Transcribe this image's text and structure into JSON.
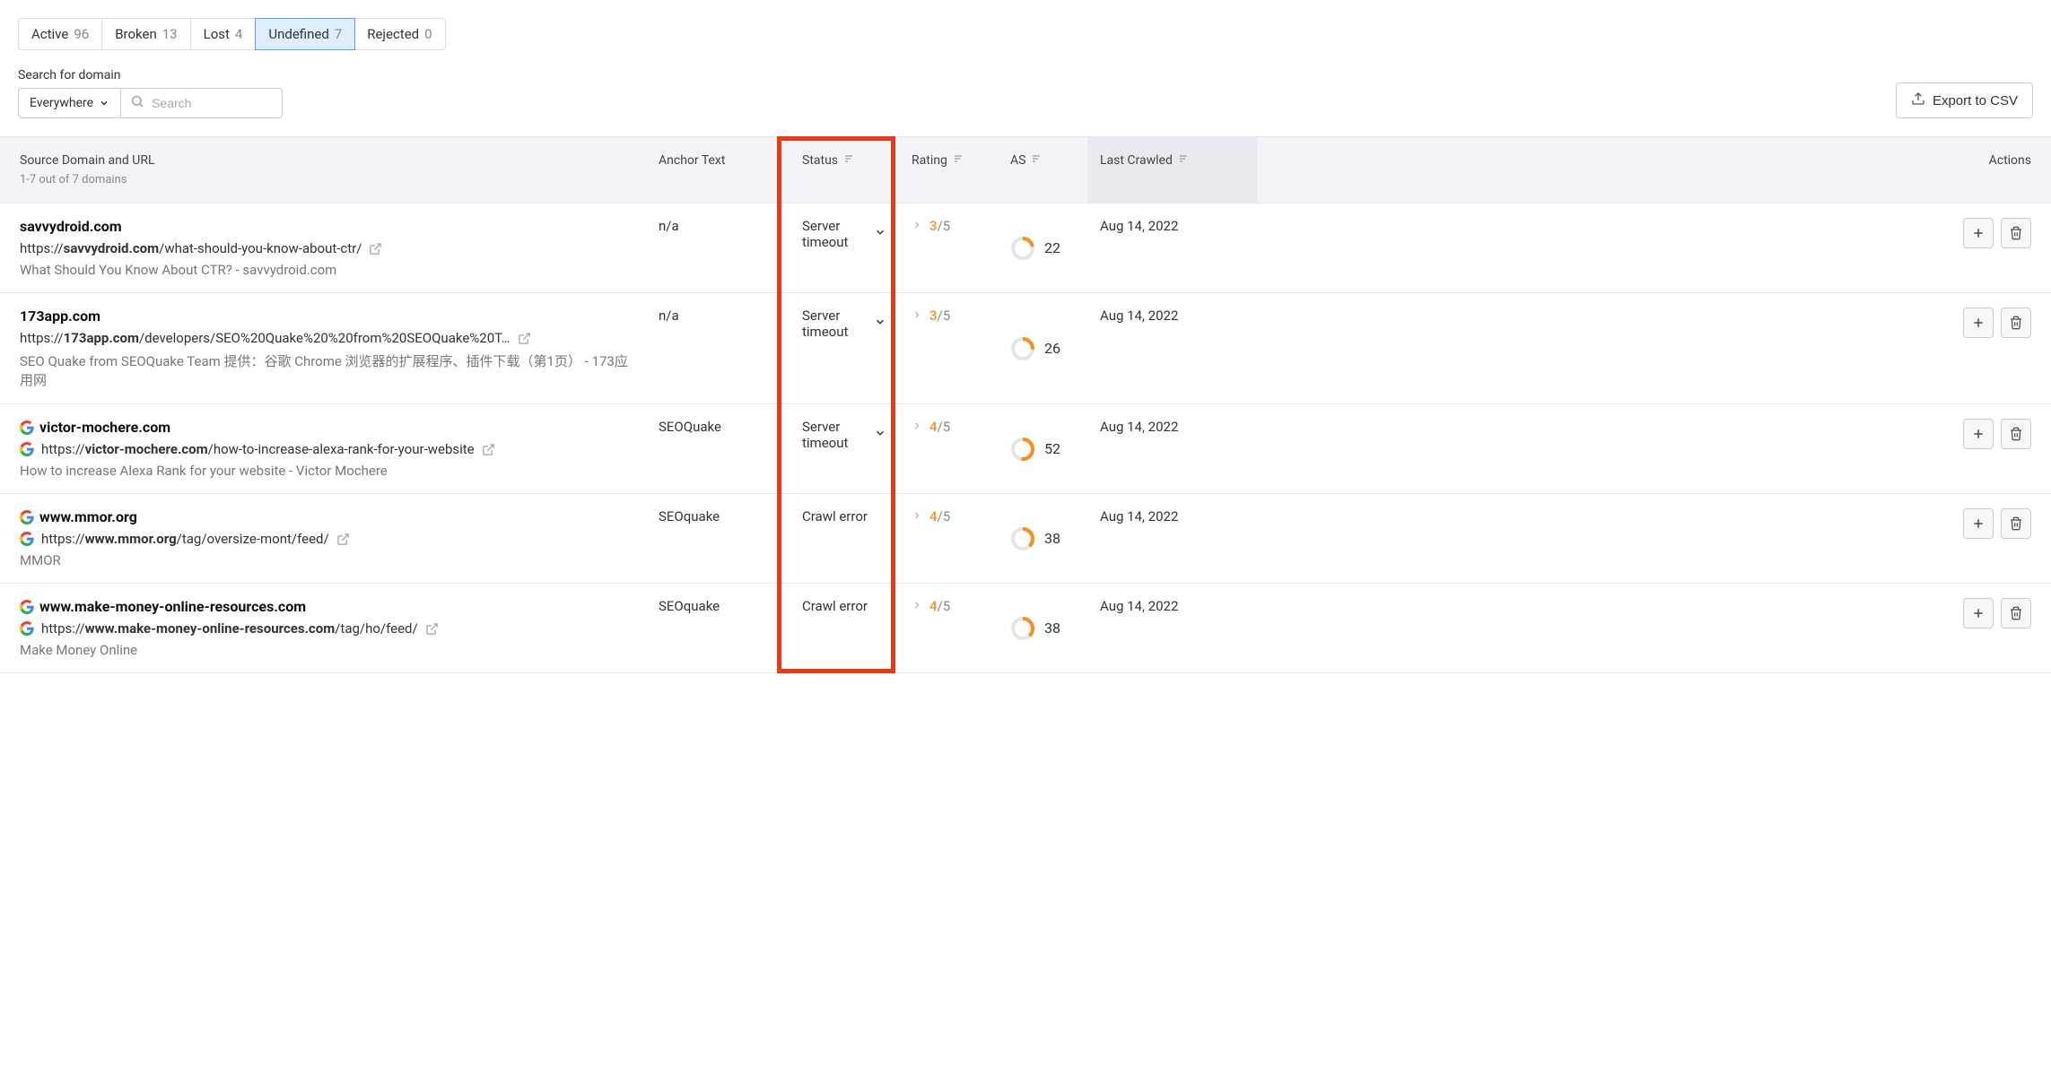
{
  "tabs": [
    {
      "label": "Active",
      "count": "96",
      "selected": false
    },
    {
      "label": "Broken",
      "count": "13",
      "selected": false
    },
    {
      "label": "Lost",
      "count": "4",
      "selected": false
    },
    {
      "label": "Undefined",
      "count": "7",
      "selected": true
    },
    {
      "label": "Rejected",
      "count": "0",
      "selected": false
    }
  ],
  "search": {
    "label": "Search for domain",
    "scope": "Everywhere",
    "placeholder": "Search"
  },
  "export_label": "Export to CSV",
  "columns": {
    "domain": "Source Domain and URL",
    "domain_sub": "1-7 out of 7 domains",
    "anchor": "Anchor Text",
    "status": "Status",
    "rating": "Rating",
    "as": "AS",
    "crawled": "Last Crawled",
    "actions": "Actions"
  },
  "rows": [
    {
      "has_favicon": false,
      "domain": "savvydroid.com",
      "url_prefix": "https://",
      "url_bold": "savvydroid.com",
      "url_rest": "/what-should-you-know-about-ctr/",
      "title": "What Should You Know About CTR? - savvydroid.com",
      "anchor": "n/a",
      "status": "Server timeout",
      "status_expandable": true,
      "rating_num": "3",
      "rating_total": "/5",
      "as": "22",
      "as_pct": 22,
      "crawled": "Aug 14, 2022"
    },
    {
      "has_favicon": false,
      "domain": "173app.com",
      "url_prefix": "https://",
      "url_bold": "173app.com",
      "url_rest": "/developers/SEO%20Quake%20%20from%20SEOQuake%20T…",
      "title": "SEO Quake from SEOQuake Team 提供：谷歌 Chrome 浏览器的扩展程序、插件下载（第1页） - 173应用网",
      "anchor": "n/a",
      "status": "Server timeout",
      "status_expandable": true,
      "rating_num": "3",
      "rating_total": "/5",
      "as": "26",
      "as_pct": 26,
      "crawled": "Aug 14, 2022"
    },
    {
      "has_favicon": true,
      "domain": "victor-mochere.com",
      "url_prefix": "https://",
      "url_bold": "victor-mochere.com",
      "url_rest": "/how-to-increase-alexa-rank-for-your-website",
      "title": "How to increase Alexa Rank for your website - Victor Mochere",
      "anchor": "SEOQuake",
      "status": "Server timeout",
      "status_expandable": true,
      "rating_num": "4",
      "rating_total": "/5",
      "as": "52",
      "as_pct": 52,
      "crawled": "Aug 14, 2022"
    },
    {
      "has_favicon": true,
      "domain": "www.mmor.org",
      "url_prefix": "https://",
      "url_bold": "www.mmor.org",
      "url_rest": "/tag/oversize-mont/feed/",
      "title": "MMOR",
      "anchor": "SEOquake",
      "status": "Crawl error",
      "status_expandable": false,
      "rating_num": "4",
      "rating_total": "/5",
      "as": "38",
      "as_pct": 38,
      "crawled": "Aug 14, 2022"
    },
    {
      "has_favicon": true,
      "domain": "www.make-money-online-resources.com",
      "url_prefix": "https://",
      "url_bold": "www.make-money-online-resources.com",
      "url_rest": "/tag/ho/feed/",
      "title": "Make Money Online",
      "anchor": "SEOquake",
      "status": "Crawl error",
      "status_expandable": false,
      "rating_num": "4",
      "rating_total": "/5",
      "as": "38",
      "as_pct": 38,
      "crawled": "Aug 14, 2022"
    }
  ]
}
